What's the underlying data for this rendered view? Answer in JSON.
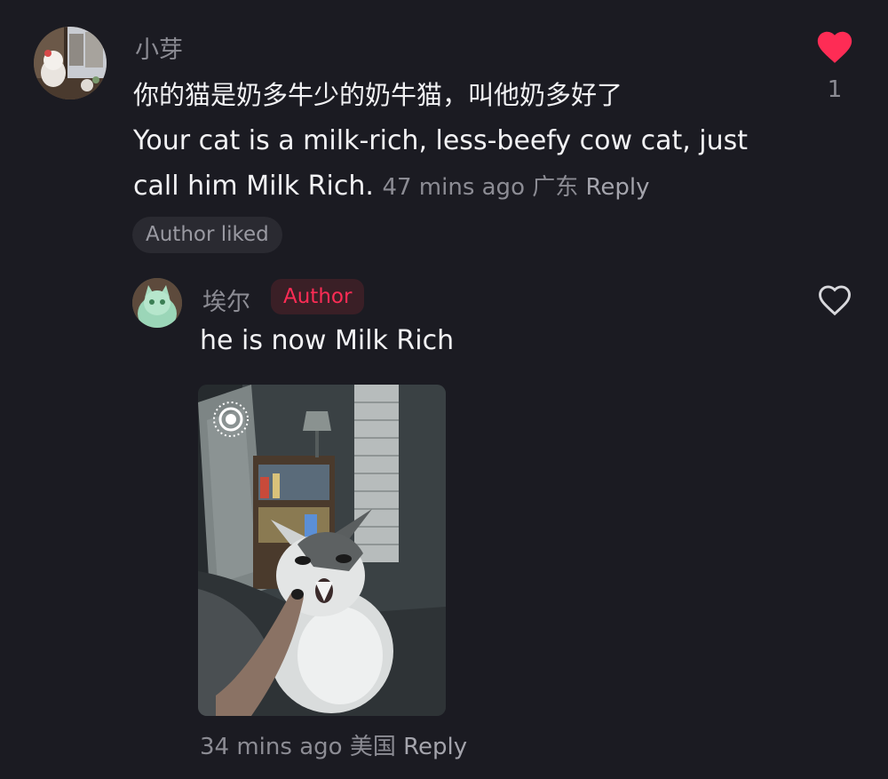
{
  "comment": {
    "username": "小芽",
    "text_zh": "你的猫是奶多牛少的奶牛猫，叫他奶多好了",
    "text_en": "Your cat is a milk-rich, less-beefy cow cat, just call him Milk Rich.",
    "time": "47 mins ago",
    "location": "广东",
    "reply_label": "Reply",
    "author_liked_label": "Author liked",
    "like_count": "1",
    "liked": true,
    "like_color": "#fe2c55"
  },
  "reply": {
    "username": "埃尔",
    "author_badge": "Author",
    "text": "he is now Milk Rich",
    "time": "34 mins ago",
    "location": "美国",
    "reply_label": "Reply",
    "liked": false,
    "photo_icon": "live-photo-icon"
  }
}
